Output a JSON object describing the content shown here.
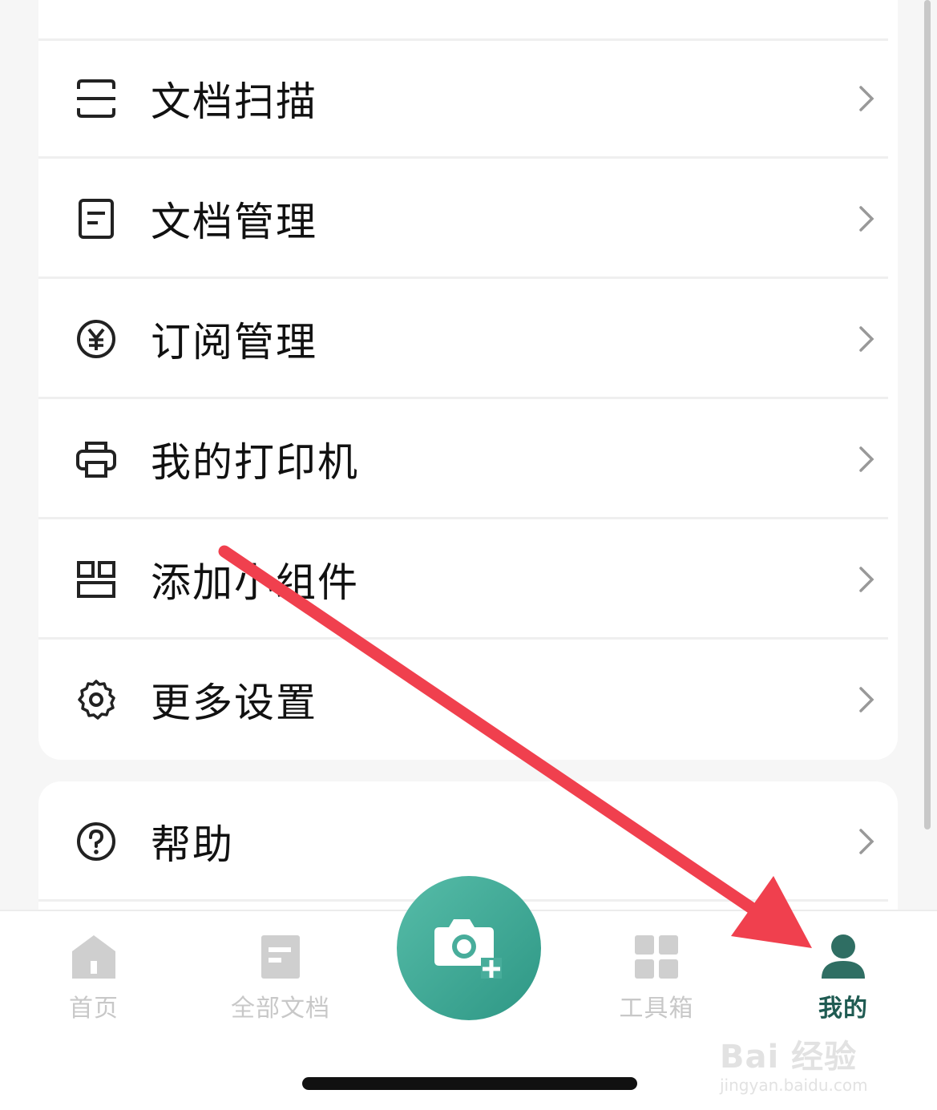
{
  "menu_items": [
    {
      "label": "文档扫描",
      "icon": "scan-icon"
    },
    {
      "label": "文档管理",
      "icon": "document-icon"
    },
    {
      "label": "订阅管理",
      "icon": "yen-icon"
    },
    {
      "label": "我的打印机",
      "icon": "printer-icon"
    },
    {
      "label": "添加小组件",
      "icon": "widget-icon"
    },
    {
      "label": "更多设置",
      "icon": "gear-icon"
    }
  ],
  "help_item": {
    "label": "帮助",
    "icon": "help-icon"
  },
  "tabbar": {
    "tabs": [
      {
        "label": "首页",
        "icon": "home-icon",
        "active": false
      },
      {
        "label": "全部文档",
        "icon": "documents-icon",
        "active": false
      },
      {
        "label": "工具箱",
        "icon": "toolbox-icon",
        "active": false
      },
      {
        "label": "我的",
        "icon": "profile-icon",
        "active": true
      }
    ],
    "camera_button": {
      "icon": "camera-plus-icon"
    }
  },
  "annotation": {
    "color": "#f0404e"
  },
  "watermark": {
    "line1": "Bai 经验",
    "line2": "jingyan.baidu.com"
  },
  "colors": {
    "accent": "#3fae9a",
    "active_tab": "#1f5b52",
    "inactive_tab": "#c8c8c8"
  }
}
